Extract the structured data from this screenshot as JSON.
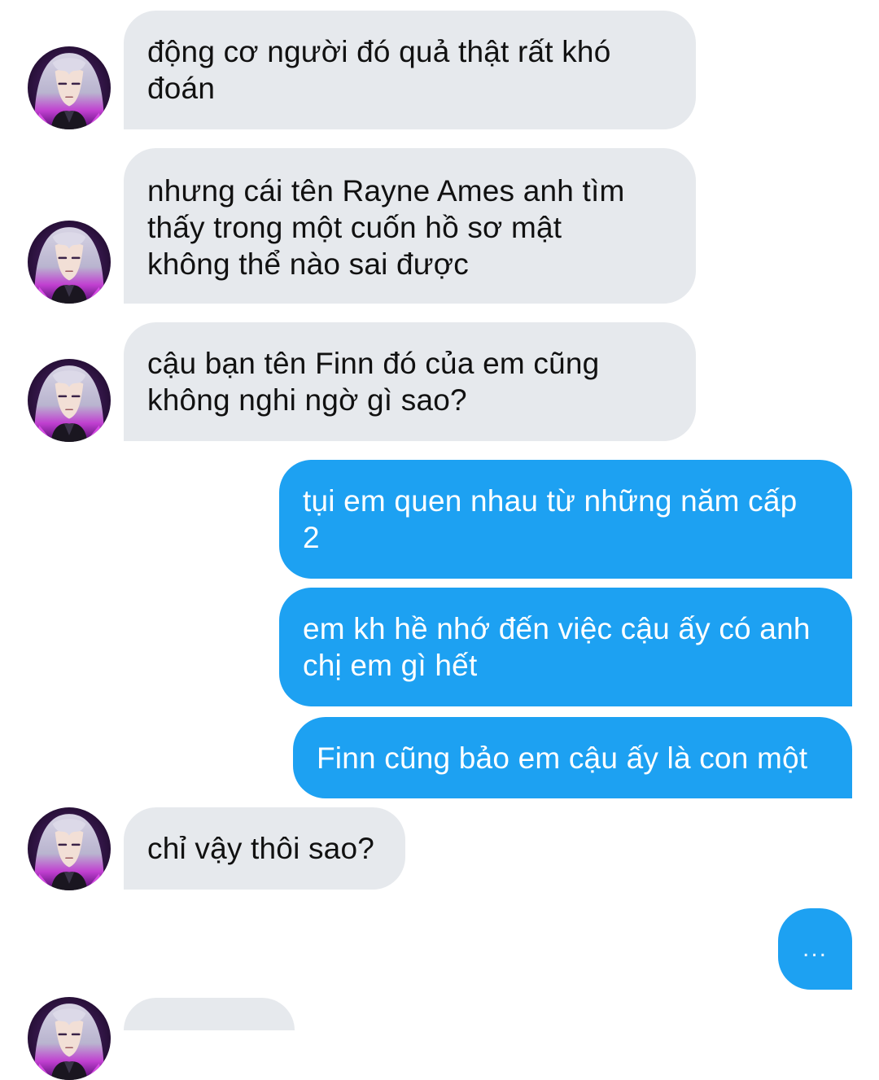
{
  "thread": {
    "messages": [
      {
        "sender": "other",
        "text": "động cơ người đó quả thật rất khó\nđoán"
      },
      {
        "sender": "other",
        "text": "nhưng cái tên Rayne Ames anh tìm\nthấy trong một cuốn hồ sơ mật\nkhông thể nào sai được"
      },
      {
        "sender": "other",
        "text": "cậu bạn tên Finn đó của em cũng\nkhông nghi ngờ gì sao?"
      },
      {
        "sender": "self",
        "text": "tụi em quen nhau từ những năm cấp\n2"
      },
      {
        "sender": "self",
        "text": "em kh hề nhớ đến việc cậu ấy có anh\nchị em gì hết"
      },
      {
        "sender": "self",
        "text": "Finn cũng bảo em cậu ấy là con một"
      },
      {
        "sender": "other",
        "text": "chỉ vậy thôi sao?"
      }
    ],
    "typing_indicator": "..."
  },
  "colors": {
    "incoming_bubble": "#e6e9ed",
    "outgoing_bubble": "#1da1f2",
    "incoming_text": "#111111",
    "outgoing_text": "#ffffff"
  },
  "icons": {
    "avatar": "avatar-anime-silver-hair"
  }
}
